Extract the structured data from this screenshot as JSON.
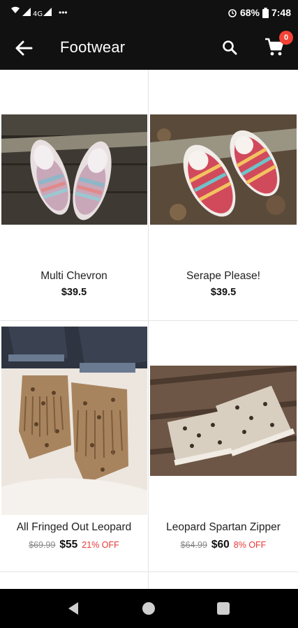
{
  "status_bar": {
    "battery": "68%",
    "time": "7:48"
  },
  "app_bar": {
    "title": "Footwear",
    "cart_count": "0"
  },
  "products": [
    {
      "name": "Multi Chevron",
      "price": "$39.5"
    },
    {
      "name": "Serape Please!",
      "price": "$39.5"
    },
    {
      "name": "All Fringed Out Leopard",
      "old_price": "$69.99",
      "price": "$55",
      "discount": "21% OFF"
    },
    {
      "name": "Leopard Spartan Zipper",
      "old_price": "$64.99",
      "price": "$60",
      "discount": "8% OFF"
    }
  ],
  "icons": {
    "back": "arrow-left-icon",
    "search": "search-icon",
    "cart": "cart-icon"
  },
  "colors": {
    "app_bar": "#111111",
    "badge": "#f44336",
    "discount": "#e53935"
  }
}
